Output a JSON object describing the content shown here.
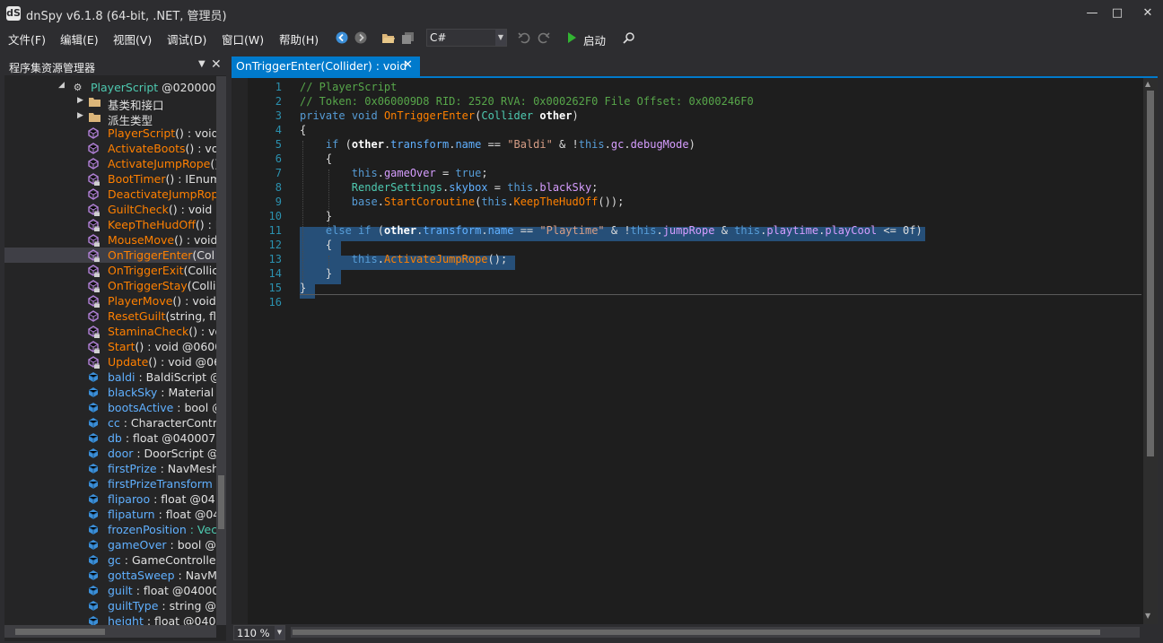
{
  "window": {
    "title": "dnSpy v6.1.8 (64-bit, .NET, 管理员)",
    "icon": "dS"
  },
  "window_controls": {
    "minimize": "—",
    "maximize": "□",
    "close": "✕"
  },
  "menu": [
    "文件(F)",
    "编辑(E)",
    "视图(V)",
    "调试(D)",
    "窗口(W)",
    "帮助(H)"
  ],
  "toolbar": {
    "language": "C#",
    "run_label": "启动"
  },
  "explorer": {
    "title": "程序集资源管理器",
    "root": {
      "name": "PlayerScript",
      "rest": " @020000D"
    },
    "folders": [
      "基类和接口",
      "派生类型"
    ],
    "members": [
      {
        "name": "PlayerScript",
        "rest": "() : void @",
        "kind": "method",
        "icon": "method-icon",
        "selected": false
      },
      {
        "name": "ActivateBoots",
        "rest": "() : void",
        "kind": "method",
        "icon": "method-icon",
        "selected": false
      },
      {
        "name": "ActivateJumpRope",
        "rest": "()",
        "kind": "method",
        "icon": "method-icon",
        "selected": false
      },
      {
        "name": "BootTimer",
        "rest": "() : IEnum",
        "kind": "method",
        "icon": "private-method-icon",
        "selected": false
      },
      {
        "name": "DeactivateJumpRop",
        "rest": "",
        "kind": "method",
        "icon": "method-icon",
        "selected": false
      },
      {
        "name": "GuiltCheck",
        "rest": "() : void @",
        "kind": "method",
        "icon": "private-method-icon",
        "selected": false
      },
      {
        "name": "KeepTheHudOff",
        "rest": "() : I",
        "kind": "method",
        "icon": "private-method-icon",
        "selected": false
      },
      {
        "name": "MouseMove",
        "rest": "() : void",
        "kind": "method",
        "icon": "private-method-icon",
        "selected": false
      },
      {
        "name": "OnTriggerEnter",
        "rest": "(Col",
        "kind": "method",
        "icon": "private-method-icon",
        "selected": true
      },
      {
        "name": "OnTriggerExit",
        "rest": "(Collic",
        "kind": "method",
        "icon": "private-method-icon",
        "selected": false
      },
      {
        "name": "OnTriggerStay",
        "rest": "(Collic",
        "kind": "method",
        "icon": "private-method-icon",
        "selected": false
      },
      {
        "name": "PlayerMove",
        "rest": "() : void",
        "kind": "method",
        "icon": "private-method-icon",
        "selected": false
      },
      {
        "name": "ResetGuilt",
        "rest": "(string, flo",
        "kind": "method",
        "icon": "method-icon",
        "selected": false
      },
      {
        "name": "StaminaCheck",
        "rest": "() : vo",
        "kind": "method",
        "icon": "private-method-icon",
        "selected": false
      },
      {
        "name": "Start",
        "rest": "() : void @0600",
        "kind": "method",
        "icon": "private-method-icon",
        "selected": false
      },
      {
        "name": "Update",
        "rest": "() : void @06",
        "kind": "method",
        "icon": "private-method-icon",
        "selected": false
      },
      {
        "name": "baldi",
        "rest": " : BaldiScript @",
        "kind": "field",
        "icon": "field-icon",
        "selected": false
      },
      {
        "name": "blackSky",
        "rest": " : Material",
        "kind": "field",
        "icon": "field-icon",
        "selected": false
      },
      {
        "name": "bootsActive",
        "rest": " : bool @",
        "kind": "field",
        "icon": "field-icon",
        "selected": false
      },
      {
        "name": "cc",
        "rest": " : CharacterContro",
        "kind": "field",
        "icon": "field-icon",
        "selected": false
      },
      {
        "name": "db",
        "rest": " : float @040007",
        "kind": "field",
        "icon": "field-icon",
        "selected": false
      },
      {
        "name": "door",
        "rest": " : DoorScript @",
        "kind": "field",
        "icon": "field-icon",
        "selected": false
      },
      {
        "name": "firstPrize",
        "rest": " : NavMesh",
        "kind": "field",
        "icon": "field-icon",
        "selected": false
      },
      {
        "name": "firstPrizeTransform",
        "rest": "",
        "kind": "field",
        "icon": "field-icon",
        "selected": false
      },
      {
        "name": "fliparoo",
        "rest": " : float @04",
        "kind": "field",
        "icon": "field-icon",
        "selected": false
      },
      {
        "name": "flipaturn",
        "rest": " : float @04",
        "kind": "field",
        "icon": "field-icon",
        "selected": false
      },
      {
        "name": "frozenPosition",
        "rest": " : Vec",
        "kind": "field-green",
        "icon": "field-icon",
        "selected": false
      },
      {
        "name": "gameOver",
        "rest": " : bool @",
        "kind": "field",
        "icon": "field-icon",
        "selected": false
      },
      {
        "name": "gc",
        "rest": " : GameControllei",
        "kind": "field",
        "icon": "field-icon",
        "selected": false
      },
      {
        "name": "gottaSweep",
        "rest": " : NavM",
        "kind": "field",
        "icon": "field-icon",
        "selected": false
      },
      {
        "name": "guilt",
        "rest": " : float @04000",
        "kind": "field",
        "icon": "field-icon",
        "selected": false
      },
      {
        "name": "guiltType",
        "rest": " : string @",
        "kind": "field",
        "icon": "field-icon",
        "selected": false
      },
      {
        "name": "height",
        "rest": " : float @0400",
        "kind": "field",
        "icon": "field-icon",
        "selected": false
      }
    ]
  },
  "tab": {
    "title": "OnTriggerEnter(Collider) : void"
  },
  "code": {
    "line_numbers": [
      "1",
      "2",
      "3",
      "4",
      "5",
      "6",
      "7",
      "8",
      "9",
      "10",
      "11",
      "12",
      "13",
      "14",
      "15",
      "16"
    ],
    "lines": [
      [
        {
          "t": "// PlayerScript",
          "c": "cm"
        }
      ],
      [
        {
          "t": "// Token: 0x060009D8 RID: 2520 RVA: 0x000262F0 File Offset: 0x000246F0",
          "c": "cm"
        }
      ],
      [
        {
          "t": "private",
          "c": "k"
        },
        {
          "t": " ",
          "c": ""
        },
        {
          "t": "void",
          "c": "k"
        },
        {
          "t": " ",
          "c": ""
        },
        {
          "t": "OnTriggerEnter",
          "c": "mt"
        },
        {
          "t": "(",
          "c": ""
        },
        {
          "t": "Collider",
          "c": "tp"
        },
        {
          "t": " ",
          "c": ""
        },
        {
          "t": "other",
          "c": "pm"
        },
        {
          "t": ")",
          "c": ""
        }
      ],
      [
        {
          "t": "{",
          "c": ""
        }
      ],
      [
        {
          "t": "    ",
          "c": ""
        },
        {
          "t": "if",
          "c": "k"
        },
        {
          "t": " (",
          "c": ""
        },
        {
          "t": "other",
          "c": "pm"
        },
        {
          "t": ".",
          "c": ""
        },
        {
          "t": "transform",
          "c": "pr"
        },
        {
          "t": ".",
          "c": ""
        },
        {
          "t": "name",
          "c": "pr"
        },
        {
          "t": " == ",
          "c": ""
        },
        {
          "t": "\"Baldi\"",
          "c": "s"
        },
        {
          "t": " & !",
          "c": ""
        },
        {
          "t": "this",
          "c": "k"
        },
        {
          "t": ".",
          "c": ""
        },
        {
          "t": "gc",
          "c": "fd"
        },
        {
          "t": ".",
          "c": ""
        },
        {
          "t": "debugMode",
          "c": "fd"
        },
        {
          "t": ")",
          "c": ""
        }
      ],
      [
        {
          "t": "    {",
          "c": ""
        }
      ],
      [
        {
          "t": "        ",
          "c": ""
        },
        {
          "t": "this",
          "c": "k"
        },
        {
          "t": ".",
          "c": ""
        },
        {
          "t": "gameOver",
          "c": "fd"
        },
        {
          "t": " = ",
          "c": ""
        },
        {
          "t": "true",
          "c": "k"
        },
        {
          "t": ";",
          "c": ""
        }
      ],
      [
        {
          "t": "        ",
          "c": ""
        },
        {
          "t": "RenderSettings",
          "c": "tp"
        },
        {
          "t": ".",
          "c": ""
        },
        {
          "t": "skybox",
          "c": "pr"
        },
        {
          "t": " = ",
          "c": ""
        },
        {
          "t": "this",
          "c": "k"
        },
        {
          "t": ".",
          "c": ""
        },
        {
          "t": "blackSky",
          "c": "fd"
        },
        {
          "t": ";",
          "c": ""
        }
      ],
      [
        {
          "t": "        ",
          "c": ""
        },
        {
          "t": "base",
          "c": "k"
        },
        {
          "t": ".",
          "c": ""
        },
        {
          "t": "StartCoroutine",
          "c": "mt"
        },
        {
          "t": "(",
          "c": ""
        },
        {
          "t": "this",
          "c": "k"
        },
        {
          "t": ".",
          "c": ""
        },
        {
          "t": "KeepTheHudOff",
          "c": "mt"
        },
        {
          "t": "());",
          "c": ""
        }
      ],
      [
        {
          "t": "    }",
          "c": ""
        }
      ],
      [
        {
          "t": "    ",
          "c": ""
        },
        {
          "t": "else",
          "c": "k"
        },
        {
          "t": " ",
          "c": ""
        },
        {
          "t": "if",
          "c": "k"
        },
        {
          "t": " (",
          "c": ""
        },
        {
          "t": "other",
          "c": "pm"
        },
        {
          "t": ".",
          "c": ""
        },
        {
          "t": "transform",
          "c": "pr"
        },
        {
          "t": ".",
          "c": ""
        },
        {
          "t": "name",
          "c": "pr"
        },
        {
          "t": " == ",
          "c": ""
        },
        {
          "t": "\"Playtime\"",
          "c": "s"
        },
        {
          "t": " & !",
          "c": ""
        },
        {
          "t": "this",
          "c": "k"
        },
        {
          "t": ".",
          "c": ""
        },
        {
          "t": "jumpRope",
          "c": "fd"
        },
        {
          "t": " & ",
          "c": ""
        },
        {
          "t": "this",
          "c": "k"
        },
        {
          "t": ".",
          "c": ""
        },
        {
          "t": "playtime",
          "c": "fd"
        },
        {
          "t": ".",
          "c": ""
        },
        {
          "t": "playCool",
          "c": "fd"
        },
        {
          "t": " <= 0f)",
          "c": ""
        }
      ],
      [
        {
          "t": "    {",
          "c": ""
        }
      ],
      [
        {
          "t": "        ",
          "c": ""
        },
        {
          "t": "this",
          "c": "k"
        },
        {
          "t": ".",
          "c": ""
        },
        {
          "t": "ActivateJumpRope",
          "c": "mt"
        },
        {
          "t": "();",
          "c": ""
        }
      ],
      [
        {
          "t": "    }",
          "c": ""
        }
      ],
      [
        {
          "t": "}",
          "c": ""
        }
      ],
      []
    ]
  },
  "status": {
    "zoom": "110 %"
  },
  "colors": {
    "accent": "#007acc",
    "background": "#2d2d30",
    "editor": "#1e1e1e",
    "selection": "#264f78"
  }
}
